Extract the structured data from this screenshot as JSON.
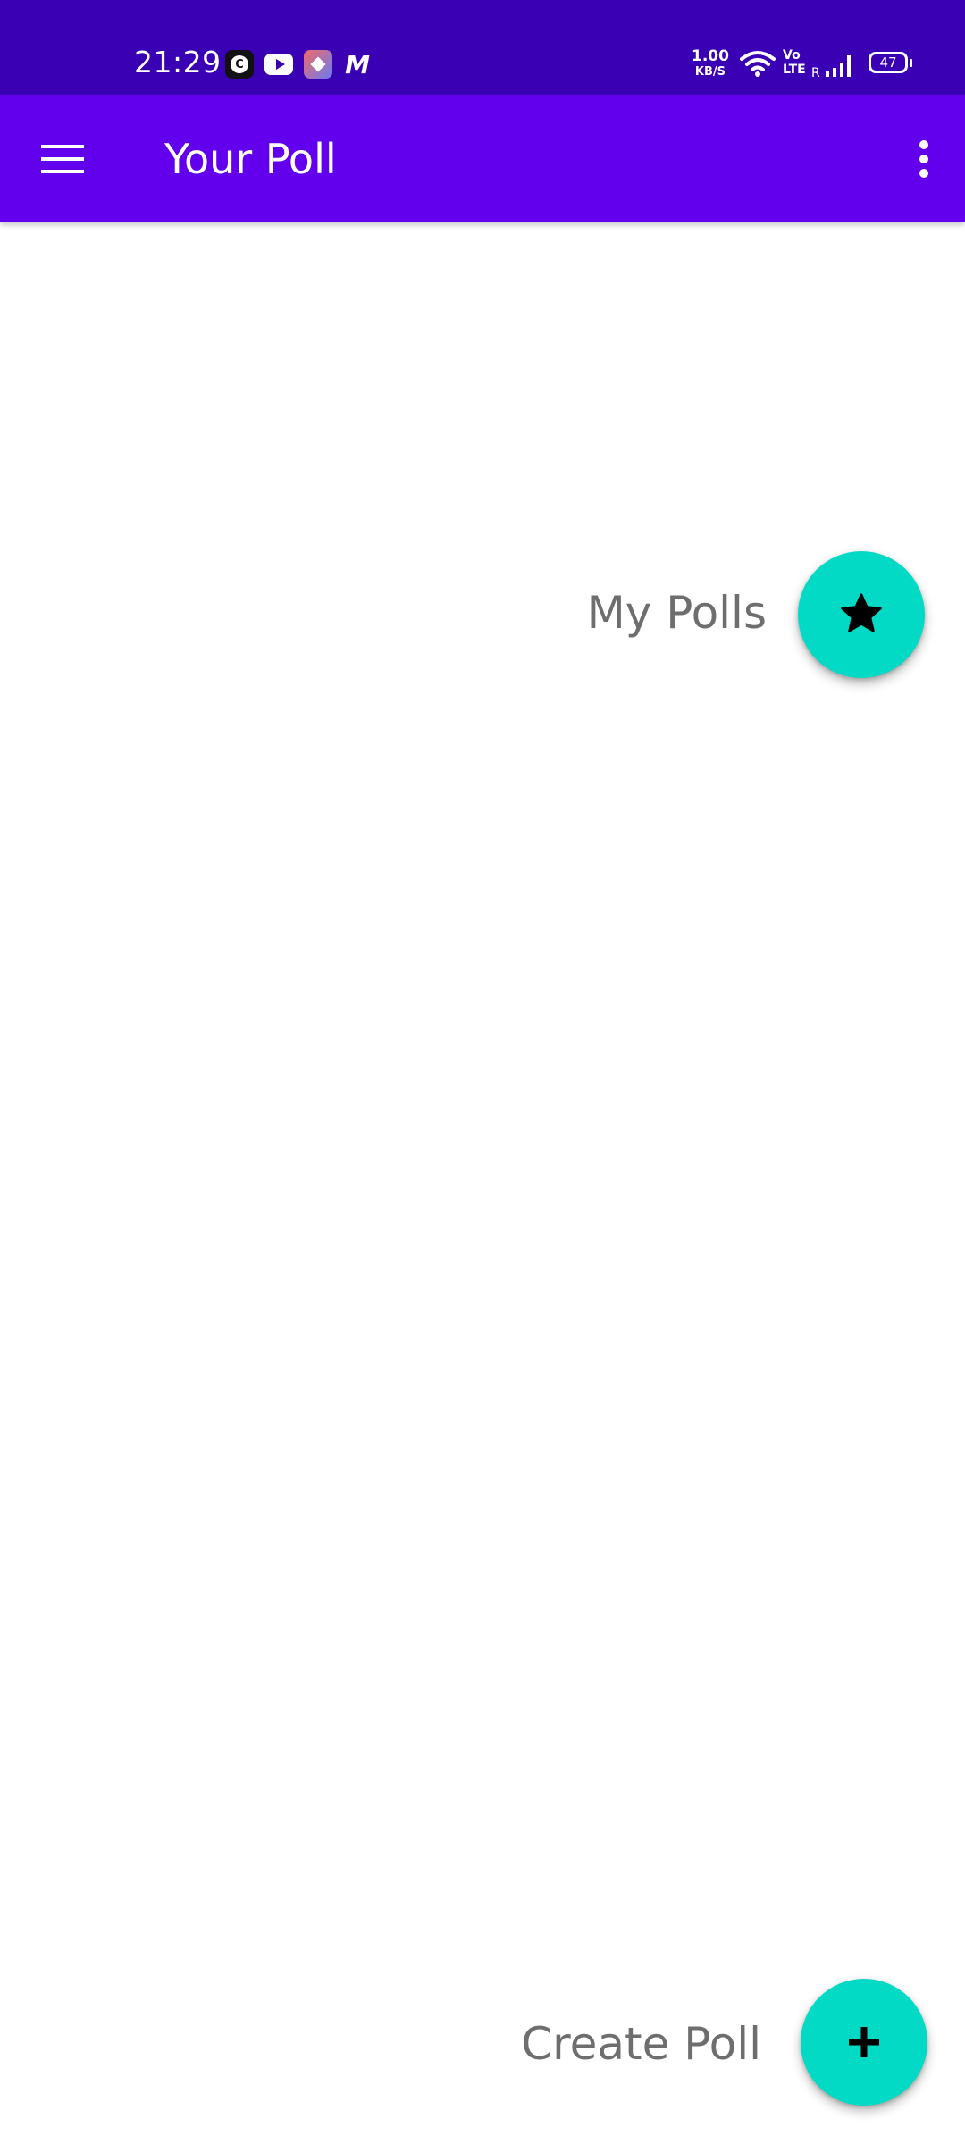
{
  "status_bar": {
    "time": "21:29",
    "net_speed_value": "1.00",
    "net_speed_unit": "KB/S",
    "volte_top": "Vo",
    "volte_bottom": "LTE",
    "roaming": "R",
    "battery_level": "47",
    "notification_icons": [
      "c-app-icon",
      "youtube-icon",
      "app-icon",
      "myntra-icon"
    ]
  },
  "app_bar": {
    "title": "Your Poll",
    "menu_icon": "hamburger-menu-icon",
    "overflow_icon": "more-vert-icon"
  },
  "fabs": {
    "my_polls": {
      "label": "My Polls",
      "icon": "star-icon"
    },
    "create_poll": {
      "label": "Create Poll",
      "icon": "plus-icon"
    }
  },
  "colors": {
    "status_bar": "#3a00b4",
    "app_bar": "#6200ee",
    "fab": "#03dac5",
    "label_text": "#6e6e6e"
  }
}
